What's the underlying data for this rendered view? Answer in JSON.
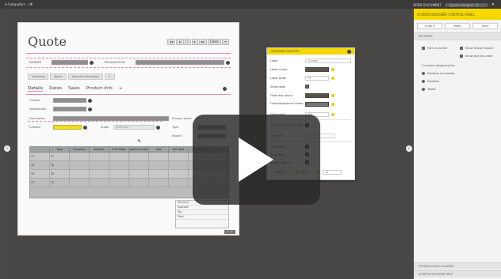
{
  "topbar": {
    "title": "e-Computers - UK",
    "open_document": "OPEN DOCUMENT",
    "pill": "Quote designer (Cl...)",
    "close": "×"
  },
  "form": {
    "title": "Quote",
    "header_buttons": [
      "◂◂",
      "◂",
      "○",
      "▸",
      "▸▸",
      "Close",
      "≡"
    ],
    "number_label": "NUMBER",
    "organisation_label": "ORGANISATION",
    "subtabs": [
      "Overview",
      "Notes",
      "Special Information",
      "+"
    ],
    "tabs": [
      "Details",
      "Dates",
      "Sales",
      "Product Info",
      "+"
    ],
    "contact_label": "Contact",
    "salesperson_label": "Salesperson",
    "description_label": "Description",
    "primary_quote_label": "Primary quote",
    "created_label": "Created",
    "stage_label": "Stage",
    "stage_value": "Draft quo",
    "type_label": "Type",
    "branch_label": "Branch",
    "grid": {
      "headers": [
        "",
        "Type",
        "Company",
        "Account",
        "Price Book",
        "List/Sub Code",
        "Unit",
        "Tool Type",
        "Quantity",
        "Price"
      ],
      "rows": [
        [
          "T1",
          "T1",
          "",
          "",
          "",
          "",
          "",
          "",
          "",
          ""
        ],
        [
          "T0",
          "T0",
          "",
          "",
          "",
          "",
          "",
          "",
          "",
          ""
        ],
        [
          "T0",
          "T0",
          "",
          "",
          "",
          "",
          "",
          "",
          "",
          ""
        ],
        [
          "T2",
          "T2",
          "",
          "",
          "",
          "",
          "",
          "",
          "",
          ""
        ]
      ]
    },
    "totals": [
      "Discount",
      "Subtotal",
      "Tax",
      "Total"
    ],
    "pager": "1 / 1"
  },
  "palette": {
    "title": "DESIGNER PALETTE",
    "label_label": "Label",
    "label_value": "Created",
    "label_colour": "Label colour",
    "label_width": "Label width",
    "label_width_value": "75",
    "show_label": "Show label",
    "field_text_colour": "Field text colour",
    "field_bg_colour": "Field background colour",
    "field_width": "Field width",
    "field_width_value": "100",
    "exclude": "Exclude from tab order",
    "tab_order": "Tab order",
    "tab_order_value": "4",
    "mandatory": "Mandatory",
    "readonly": "Read only",
    "hidden_default": "Hidden default",
    "output": "Output",
    "output_value": "none",
    "output_num": "10"
  },
  "rpanel": {
    "head": "SCREEN DESIGNER CONTROL PANEL",
    "buttons": [
      "Undo  ▾",
      "Redo",
      "Save"
    ],
    "settings": "SETTINGS",
    "form_active": "Form is active",
    "show_design": "Show design layout",
    "show_tab_order": "Show tab key order",
    "currently": "Currently designing for...",
    "desktop_tablet": "Desktop and tablet",
    "desktop": "Desktop",
    "tablet": "Tablet",
    "permissions": "PERMISSIONS & SHARING",
    "help": "SCREEN DESIGNER HELP"
  },
  "colors": {
    "accent": "#f4d800",
    "pink": "#e38ab3"
  }
}
